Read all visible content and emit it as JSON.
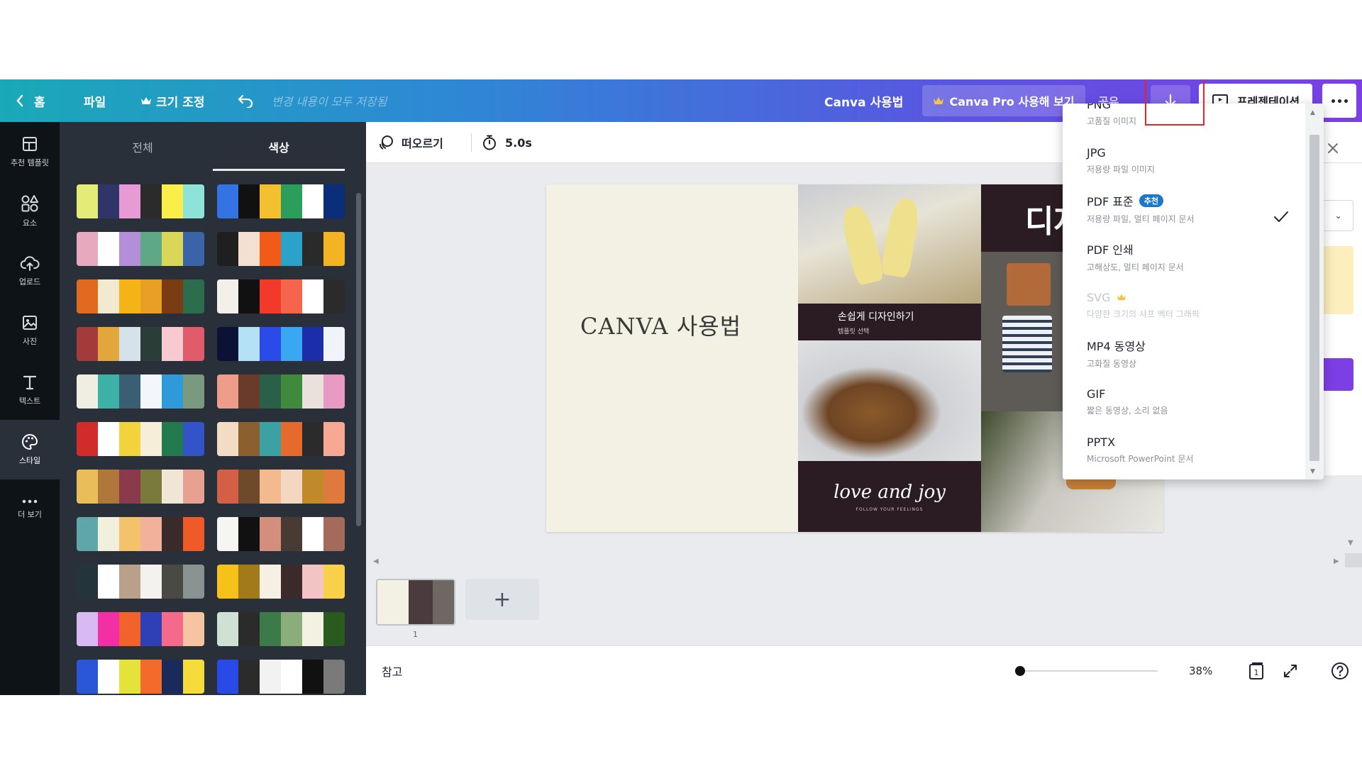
{
  "header": {
    "home_label": "홈",
    "file_label": "파일",
    "resize_label": "크기 조정",
    "saved_status": "변경 내용이 모두 저장됨",
    "doc_title": "Canva 사용법",
    "pro_label": "Canva Pro 사용해 보기",
    "share_label": "공유",
    "present_label": "프레젠테이션",
    "crown_color": "#f6c344",
    "download_highlight_color": "#e0262b"
  },
  "rail": {
    "items": [
      {
        "label": "추천 템플릿",
        "icon": "template-icon"
      },
      {
        "label": "요소",
        "icon": "shapes-icon"
      },
      {
        "label": "업로드",
        "icon": "cloud-upload-icon"
      },
      {
        "label": "사진",
        "icon": "photo-icon"
      },
      {
        "label": "텍스트",
        "icon": "text-icon"
      },
      {
        "label": "스타일",
        "icon": "palette-icon"
      },
      {
        "label": "더 보기",
        "icon": "more-icon"
      }
    ]
  },
  "panel": {
    "tabs": [
      "전체",
      "색상"
    ],
    "active_tab": "색상",
    "palettes": [
      [
        "#e3ec76",
        "#2f3566",
        "#e79ad4",
        "#2b2b2b",
        "#f8ef4b",
        "#8de3d8"
      ],
      [
        "#3373e3",
        "#111111",
        "#f3c02f",
        "#2d9d5b",
        "#ffffff",
        "#0b2e7a"
      ],
      [
        "#e7a9bd",
        "#ffffff",
        "#b38fd9",
        "#5fa886",
        "#d9d65a",
        "#3a63a8"
      ],
      [
        "#1f1f1f",
        "#f3e0d0",
        "#f25a18",
        "#2aa2c9",
        "#2a2a2a",
        "#f4b322"
      ],
      [
        "#e06a1f",
        "#f1ead0",
        "#f4b416",
        "#e89f24",
        "#7a3c12",
        "#2b6d4c"
      ],
      [
        "#f3f0ea",
        "#111111",
        "#f23a2b",
        "#f5654c",
        "#ffffff",
        "#2b2b2b"
      ],
      [
        "#a33b3b",
        "#e1a63c",
        "#d6e2ea",
        "#2b3d37",
        "#f8c9d1",
        "#e25b6a"
      ],
      [
        "#0b1236",
        "#b4e1f4",
        "#2b4be8",
        "#3aa7f3",
        "#1b2da8",
        "#f1f3fb"
      ],
      [
        "#f0ede3",
        "#3bb2a5",
        "#3a5e73",
        "#f4f7f9",
        "#2e9ad9",
        "#7a9a80"
      ],
      [
        "#ee9d8a",
        "#6a3a2a",
        "#2a5f4a",
        "#3f8a3c",
        "#ebe1dc",
        "#e99ac4"
      ],
      [
        "#d22b2b",
        "#ffffff",
        "#f2d33c",
        "#f6eed8",
        "#237a4e",
        "#3353c8"
      ],
      [
        "#f2dcc4",
        "#8c5f2f",
        "#3ba1a3",
        "#e66a2c",
        "#2b2b2b",
        "#f6a892"
      ],
      [
        "#e9be5a",
        "#b0773b",
        "#8a3a4a",
        "#7a7a3a",
        "#f1e6d6",
        "#e8a090"
      ],
      [
        "#d35f46",
        "#6e4a2a",
        "#f4b98e",
        "#f3d7c0",
        "#c08a2a",
        "#e07a3c"
      ],
      [
        "#5fa6a8",
        "#f2f0dd",
        "#f4c26a",
        "#f1b19a",
        "#3a2a2a",
        "#f05a28"
      ],
      [
        "#f5f5f2",
        "#111111",
        "#d38e7e",
        "#4a3a34",
        "#ffffff",
        "#a56b5a"
      ],
      [
        "#23343b",
        "#ffffff",
        "#b9a08a",
        "#f4f2ee",
        "#4a4a44",
        "#8a9292"
      ],
      [
        "#f6c21a",
        "#a37a1a",
        "#f6efe3",
        "#3a2a2a",
        "#f2c4c4",
        "#f8d04a"
      ],
      [
        "#d9b9f2",
        "#f32fa5",
        "#f2632b",
        "#2f3fb5",
        "#f56a8a",
        "#f6c4a0"
      ],
      [
        "#cfe1d2",
        "#2b2b2b",
        "#3c7a4a",
        "#8aad7a",
        "#f3f1e2",
        "#2a5a1e"
      ],
      [
        "#2a56d8",
        "#ffffff",
        "#e5e23a",
        "#f36a2a",
        "#1a2a5a",
        "#f6dc3a"
      ],
      [
        "#2a4ae8",
        "#2b2b2b",
        "#f2f2f2",
        "#ffffff",
        "#111111",
        "#7a7a7a"
      ]
    ]
  },
  "toolbar": {
    "animate_label": "떠오르기",
    "duration_label": "5.0s"
  },
  "slide": {
    "title": "CANVA 사용법",
    "caption_main": "손쉽게 디자인하기",
    "caption_sub": "템플릿 선택",
    "script_text": "love and joy",
    "script_sub": "FOLLOW YOUR FEELINGS",
    "heading_partial": "디자"
  },
  "pages": {
    "page_number": "1",
    "add_label": "+"
  },
  "footer": {
    "notes_label": "참고",
    "zoom_percent": 38,
    "zoom_label": "38%",
    "page_count_label": "1"
  },
  "download_menu": {
    "items": [
      {
        "title": "PNG",
        "desc": "고품질 이미지",
        "badge": "",
        "disabled": false,
        "pro": false
      },
      {
        "title": "JPG",
        "desc": "저용량 파일 이미지",
        "badge": "",
        "disabled": false,
        "pro": false
      },
      {
        "title": "PDF 표준",
        "desc": "저용량 파일, 멀티 페이지 문서",
        "badge": "추천",
        "disabled": false,
        "pro": false,
        "selected": true
      },
      {
        "title": "PDF 인쇄",
        "desc": "고해상도, 멀티 페이지 문서",
        "badge": "",
        "disabled": false,
        "pro": false
      },
      {
        "title": "SVG",
        "desc": "다양한 크기의 샤프 벡터 그래픽",
        "badge": "",
        "disabled": true,
        "pro": true
      },
      {
        "title": "MP4 동영상",
        "desc": "고화질 동영상",
        "badge": "",
        "disabled": false,
        "pro": false
      },
      {
        "title": "GIF",
        "desc": "짧은 동영상, 소리 없음",
        "badge": "",
        "disabled": false,
        "pro": false
      },
      {
        "title": "PPTX",
        "desc": "Microsoft PowerPoint 문서",
        "badge": "",
        "disabled": false,
        "pro": false
      }
    ]
  }
}
